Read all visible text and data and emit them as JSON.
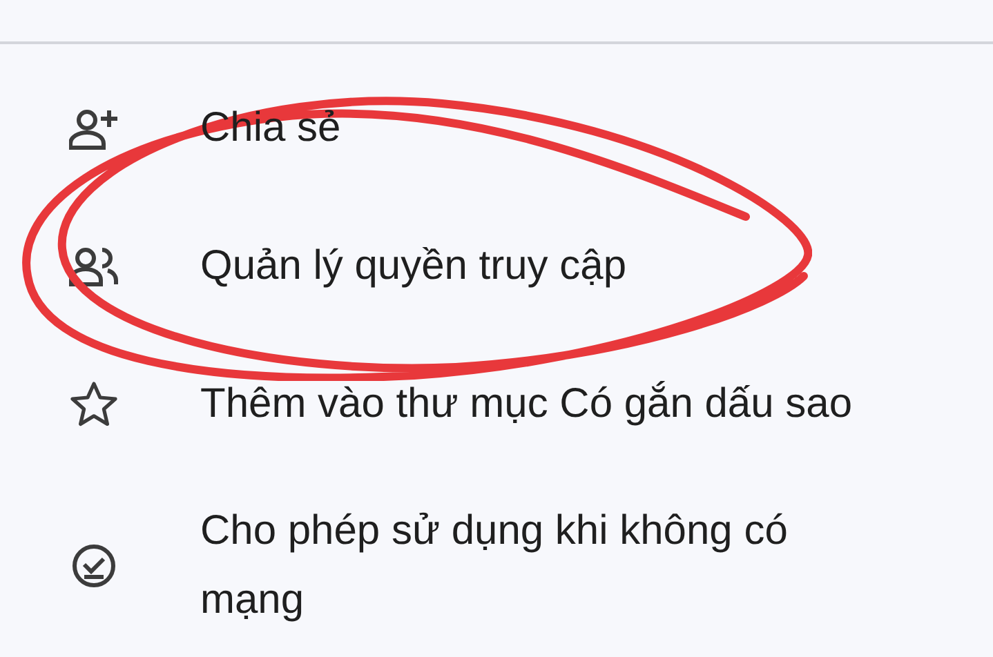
{
  "menu": {
    "items": [
      {
        "label": "Chia sẻ",
        "kind": "share"
      },
      {
        "label": "Quản lý quyền truy cập",
        "kind": "access"
      },
      {
        "label": "Thêm vào thư mục Có gắn dấu sao",
        "kind": "starred"
      },
      {
        "label": "Cho phép sử dụng khi không có mạng",
        "kind": "offline"
      }
    ]
  }
}
